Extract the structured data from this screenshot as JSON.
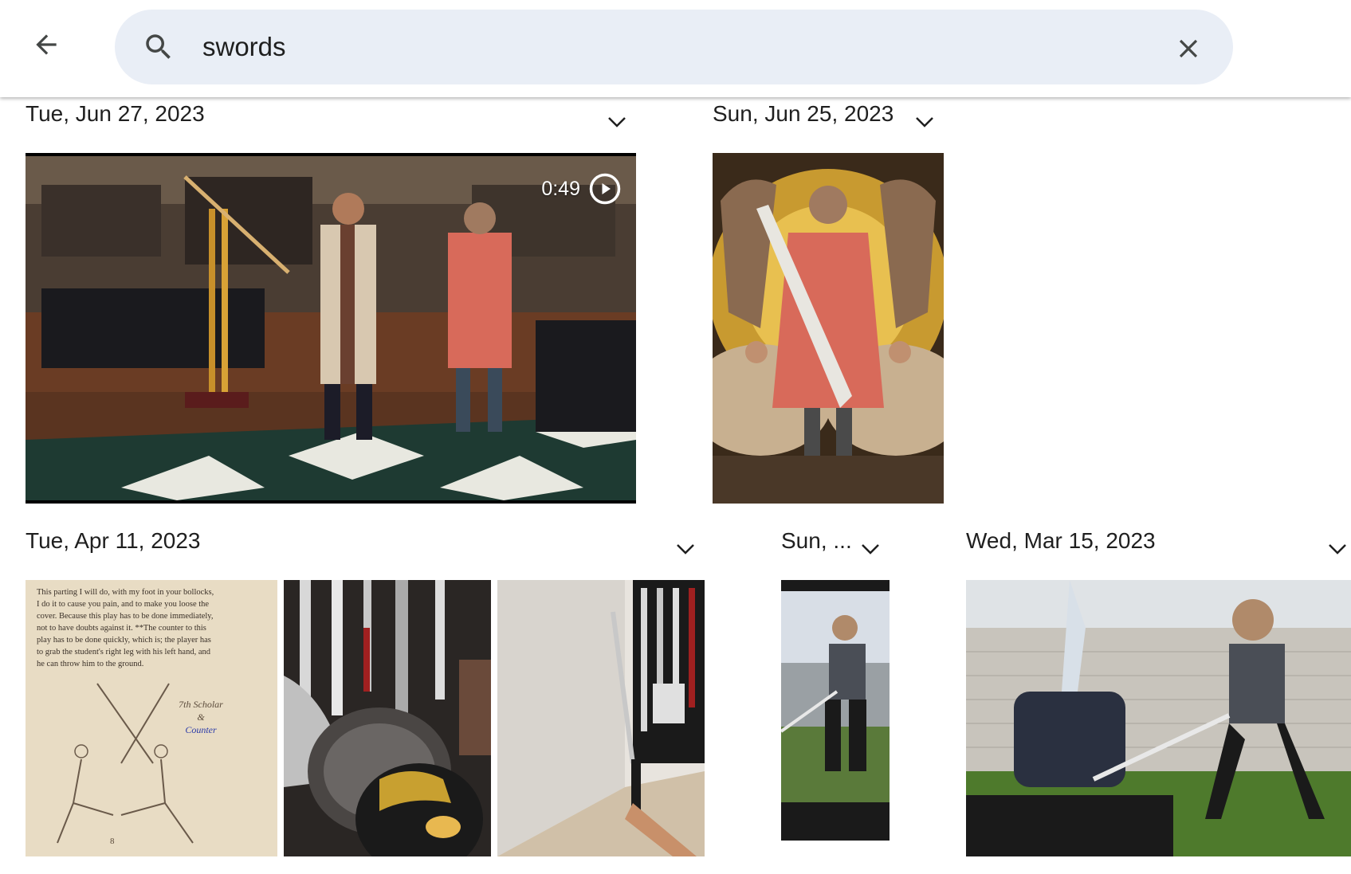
{
  "search": {
    "query": "swords"
  },
  "groups": [
    {
      "date": "Tue, Jun 27, 2023",
      "items": [
        {
          "type": "video",
          "duration": "0:49"
        }
      ]
    },
    {
      "date": "Sun, Jun 25, 2023",
      "items": [
        {
          "type": "photo"
        }
      ]
    },
    {
      "date": "Tue, Apr 11, 2023",
      "items": [
        {
          "type": "photo",
          "text_lines": [
            "This parting I will do, with my foot in your bollocks,",
            "I do it to cause you pain, and to make you loose the",
            "cover. Because this play has to be done immediately,",
            "not to have doubts against it. **The counter to this",
            "play has to be done quickly, which is; the player has",
            "to grab the student's right leg with his left hand, and",
            "he can throw him to the ground."
          ],
          "caption1": "7th Scholar",
          "caption2": "&",
          "caption3": "Counter",
          "page_mark": "8"
        },
        {
          "type": "photo"
        },
        {
          "type": "photo"
        }
      ]
    },
    {
      "date": "Sun, ...",
      "items": [
        {
          "type": "photo"
        }
      ]
    },
    {
      "date": "Wed, Mar 15, 2023",
      "items": [
        {
          "type": "photo"
        }
      ]
    }
  ],
  "colors": {
    "search_bg": "#e9eef6",
    "accent": "#1f1f1f"
  }
}
